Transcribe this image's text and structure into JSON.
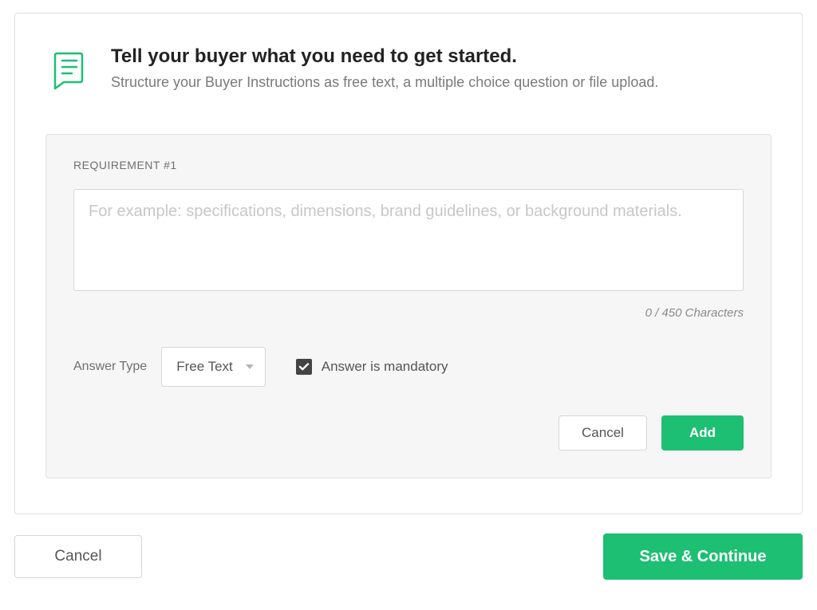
{
  "header": {
    "title": "Tell your buyer what you need to get started.",
    "subtitle": "Structure your Buyer Instructions as free text, a multiple choice question or file upload."
  },
  "requirement": {
    "label": "REQUIREMENT #1",
    "placeholder": "For example: specifications, dimensions, brand guidelines, or background materials.",
    "value": "",
    "counter": "0 / 450 Characters",
    "answer_type_label": "Answer Type",
    "answer_type_value": "Free Text",
    "mandatory_label": "Answer is mandatory",
    "mandatory_checked": true,
    "cancel_label": "Cancel",
    "add_label": "Add"
  },
  "footer": {
    "cancel_label": "Cancel",
    "save_label": "Save & Continue"
  }
}
